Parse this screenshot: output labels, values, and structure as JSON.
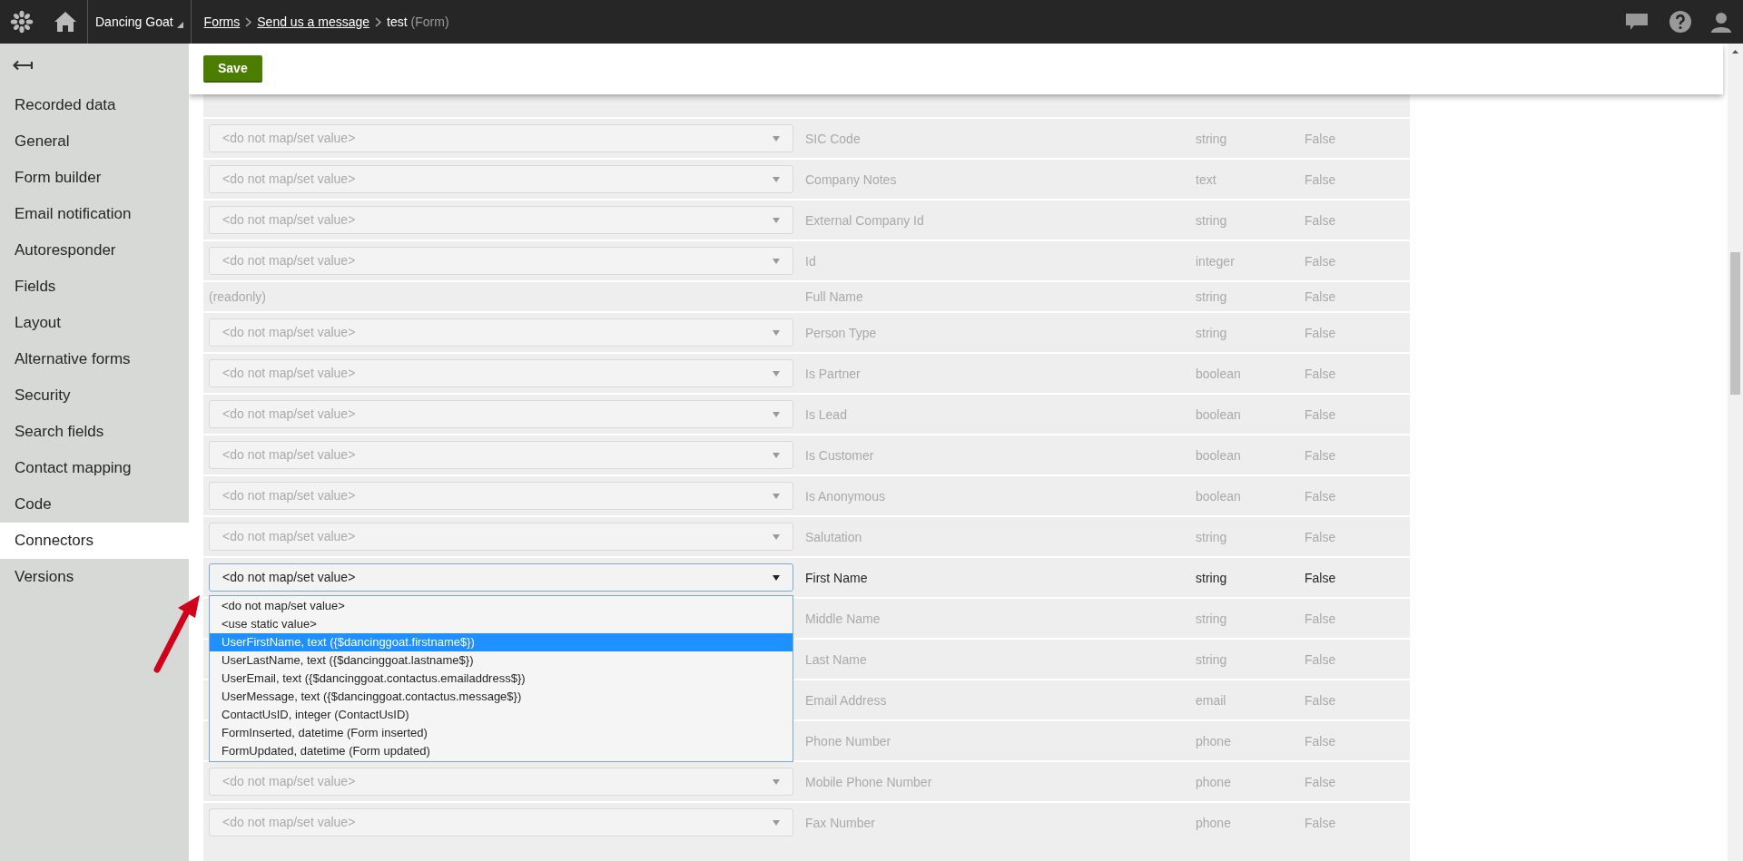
{
  "top_bar": {
    "site": "Dancing Goat",
    "breadcrumbs": [
      {
        "text": "Forms",
        "kind": "link"
      },
      {
        "text": "Send us a message",
        "kind": "link"
      },
      {
        "text": "test",
        "kind": "current"
      }
    ],
    "object_type": "(Form)"
  },
  "sidebar": {
    "items": [
      {
        "label": "Recorded data",
        "selected": false
      },
      {
        "label": "General",
        "selected": false
      },
      {
        "label": "Form builder",
        "selected": false
      },
      {
        "label": "Email notification",
        "selected": false
      },
      {
        "label": "Autoresponder",
        "selected": false
      },
      {
        "label": "Fields",
        "selected": false
      },
      {
        "label": "Layout",
        "selected": false
      },
      {
        "label": "Alternative forms",
        "selected": false
      },
      {
        "label": "Security",
        "selected": false
      },
      {
        "label": "Search fields",
        "selected": false
      },
      {
        "label": "Contact mapping",
        "selected": false
      },
      {
        "label": "Code",
        "selected": false
      },
      {
        "label": "Connectors",
        "selected": true
      },
      {
        "label": "Versions",
        "selected": false
      }
    ]
  },
  "toolbar": {
    "save": "Save"
  },
  "mapping": {
    "rows": [
      {
        "kind": "select",
        "value": "<do not map/set value>",
        "field": "SIC Code",
        "type": "string",
        "required": "False",
        "expanded": false
      },
      {
        "kind": "select",
        "value": "<do not map/set value>",
        "field": "Company Notes",
        "type": "text",
        "required": "False",
        "expanded": false
      },
      {
        "kind": "select",
        "value": "<do not map/set value>",
        "field": "External Company Id",
        "type": "string",
        "required": "False",
        "expanded": false
      },
      {
        "kind": "select",
        "value": "<do not map/set value>",
        "field": "Id",
        "type": "integer",
        "required": "False",
        "expanded": false
      },
      {
        "kind": "readonly",
        "value": "(readonly)",
        "field": "Full Name",
        "type": "string",
        "required": "False",
        "expanded": false
      },
      {
        "kind": "select",
        "value": "<do not map/set value>",
        "field": "Person Type",
        "type": "string",
        "required": "False",
        "expanded": false
      },
      {
        "kind": "select",
        "value": "<do not map/set value>",
        "field": "Is Partner",
        "type": "boolean",
        "required": "False",
        "expanded": false
      },
      {
        "kind": "select",
        "value": "<do not map/set value>",
        "field": "Is Lead",
        "type": "boolean",
        "required": "False",
        "expanded": false
      },
      {
        "kind": "select",
        "value": "<do not map/set value>",
        "field": "Is Customer",
        "type": "boolean",
        "required": "False",
        "expanded": false
      },
      {
        "kind": "select",
        "value": "<do not map/set value>",
        "field": "Is Anonymous",
        "type": "boolean",
        "required": "False",
        "expanded": false
      },
      {
        "kind": "select",
        "value": "<do not map/set value>",
        "field": "Salutation",
        "type": "string",
        "required": "False",
        "expanded": false
      },
      {
        "kind": "select",
        "value": "<do not map/set value>",
        "field": "First Name",
        "type": "string",
        "required": "False",
        "expanded": true
      },
      {
        "kind": "covered",
        "field": "Middle Name",
        "type": "string",
        "required": "False",
        "expanded": false
      },
      {
        "kind": "covered",
        "field": "Last Name",
        "type": "string",
        "required": "False",
        "expanded": false
      },
      {
        "kind": "covered",
        "field": "Email Address",
        "type": "email",
        "required": "False",
        "expanded": false
      },
      {
        "kind": "covered",
        "field": "Phone Number",
        "type": "phone",
        "required": "False",
        "expanded": false
      },
      {
        "kind": "select",
        "value": "<do not map/set value>",
        "field": "Mobile Phone Number",
        "type": "phone",
        "required": "False",
        "expanded": false
      },
      {
        "kind": "select",
        "value": "<do not map/set value>",
        "field": "Fax Number",
        "type": "phone",
        "required": "False",
        "expanded": false
      }
    ],
    "dropdown_options": [
      {
        "label": "<do not map/set value>",
        "selected": false
      },
      {
        "label": "<use static value>",
        "selected": false
      },
      {
        "label": "UserFirstName, text ({$dancinggoat.firstname$})",
        "selected": true
      },
      {
        "label": "UserLastName, text ({$dancinggoat.lastname$})",
        "selected": false
      },
      {
        "label": "UserEmail, text ({$dancinggoat.contactus.emailaddress$})",
        "selected": false
      },
      {
        "label": "UserMessage, text ({$dancinggoat.contactus.message$})",
        "selected": false
      },
      {
        "label": "ContactUsID, integer (ContactUsID)",
        "selected": false
      },
      {
        "label": "FormInserted, datetime (Form inserted)",
        "selected": false
      },
      {
        "label": "FormUpdated, datetime (Form updated)",
        "selected": false
      }
    ]
  }
}
